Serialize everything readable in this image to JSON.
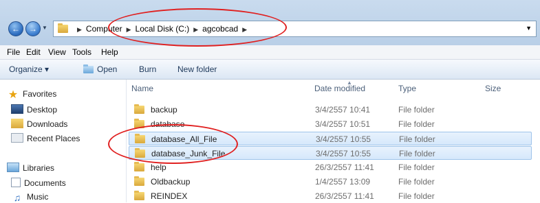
{
  "address_bar": {
    "breadcrumbs": [
      "Computer",
      "Local Disk (C:)",
      "agcobcad"
    ],
    "dropdown_icon": "chevron-down-icon"
  },
  "menu": [
    "File",
    "Edit",
    "View",
    "Tools",
    "Help"
  ],
  "commands": {
    "organize": "Organize ▾",
    "open": "Open",
    "burn": "Burn",
    "new_folder": "New folder"
  },
  "nav": {
    "favorites": "Favorites",
    "desktop": "Desktop",
    "downloads": "Downloads",
    "recent": "Recent Places",
    "libraries": "Libraries",
    "documents": "Documents",
    "music": "Music"
  },
  "columns": {
    "name": "Name",
    "date": "Date modified",
    "type": "Type",
    "size": "Size"
  },
  "files": [
    {
      "name": "backup",
      "date": "3/4/2557 10:41",
      "type": "File folder",
      "selected": false
    },
    {
      "name": "database",
      "date": "3/4/2557 10:51",
      "type": "File folder",
      "selected": false
    },
    {
      "name": "database_All_File",
      "date": "3/4/2557 10:55",
      "type": "File folder",
      "selected": true
    },
    {
      "name": "database_Junk_File",
      "date": "3/4/2557 10:55",
      "type": "File folder",
      "selected": true
    },
    {
      "name": "help",
      "date": "26/3/2557 11:41",
      "type": "File folder",
      "selected": false
    },
    {
      "name": "Oldbackup",
      "date": "1/4/2557 13:09",
      "type": "File folder",
      "selected": false
    },
    {
      "name": "REINDEX",
      "date": "26/3/2557 11:41",
      "type": "File folder",
      "selected": false
    }
  ],
  "colors": {
    "annotation": "#e02020",
    "selection": "#d6e8fb"
  }
}
